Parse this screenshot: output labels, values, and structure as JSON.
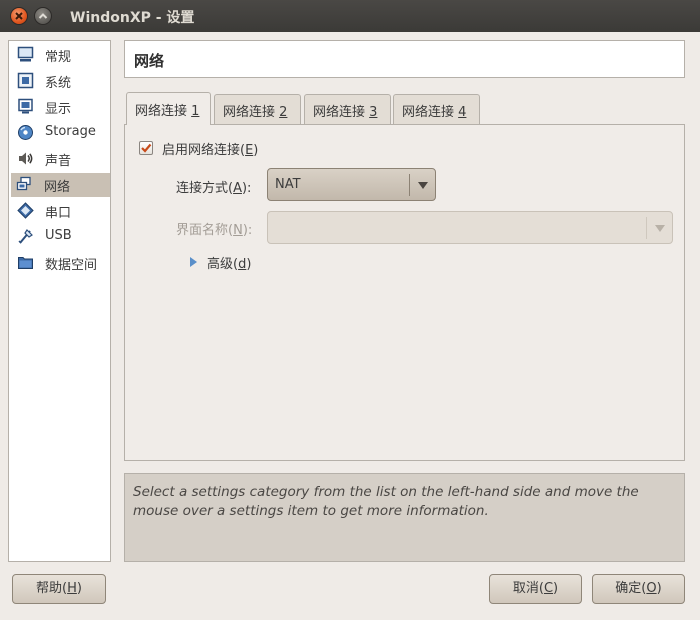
{
  "window": {
    "title": "WindonXP - 设置"
  },
  "sidebar": {
    "items": [
      {
        "label": "常规",
        "icon": "monitor-icon",
        "selected": false
      },
      {
        "label": "系统",
        "icon": "motherboard-icon",
        "selected": false
      },
      {
        "label": "显示",
        "icon": "display-icon",
        "selected": false
      },
      {
        "label": "Storage",
        "icon": "disc-icon",
        "selected": false
      },
      {
        "label": "声音",
        "icon": "speaker-icon",
        "selected": false
      },
      {
        "label": "网络",
        "icon": "network-icon",
        "selected": true
      },
      {
        "label": "串口",
        "icon": "serial-port-icon",
        "selected": false
      },
      {
        "label": "USB",
        "icon": "usb-icon",
        "selected": false
      },
      {
        "label": "数据空间",
        "icon": "folder-icon",
        "selected": false
      }
    ]
  },
  "header": {
    "title": "网络"
  },
  "tabs": [
    {
      "label": "网络连接 ",
      "mnemonic": "1",
      "active": true
    },
    {
      "label": "网络连接 ",
      "mnemonic": "2",
      "active": false
    },
    {
      "label": "网络连接 ",
      "mnemonic": "3",
      "active": false
    },
    {
      "label": "网络连接 ",
      "mnemonic": "4",
      "active": false
    }
  ],
  "adapter": {
    "enable": {
      "label_pre": "启用网络连接(",
      "mnemonic": "E",
      "label_post": ")",
      "checked": true
    },
    "attached": {
      "label_pre": "连接方式(",
      "mnemonic": "A",
      "label_post": "):",
      "value": "NAT"
    },
    "name": {
      "label_pre": "界面名称(",
      "mnemonic": "N",
      "label_post": "):",
      "value": "",
      "enabled": false
    },
    "advanced": {
      "label_pre": "高级(",
      "mnemonic": "d",
      "label_post": ")"
    }
  },
  "info": {
    "text": "Select a settings category from the list on the left-hand side and move the mouse over a settings item to get more information."
  },
  "buttons": {
    "help": {
      "pre": "帮助(",
      "mnemonic": "H",
      "post": ")"
    },
    "cancel": {
      "pre": "取消(",
      "mnemonic": "C",
      "post": ")"
    },
    "ok": {
      "pre": "确定(",
      "mnemonic": "O",
      "post": ")"
    }
  },
  "colors": {
    "accent": "#e0561f",
    "selection": "#c9c0b4",
    "background": "#efebe7"
  }
}
